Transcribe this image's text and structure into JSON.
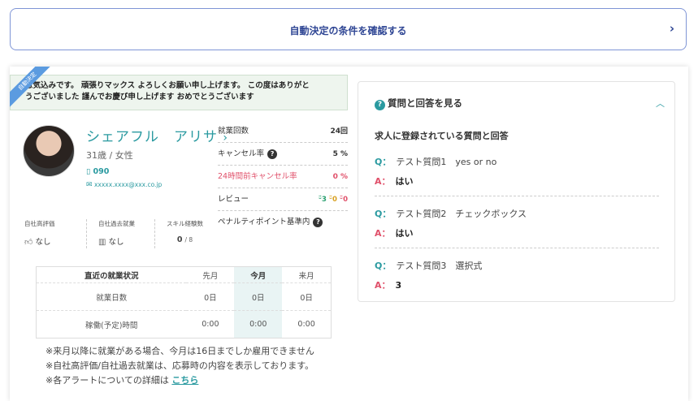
{
  "top_bar": {
    "label": "自動決定の条件を確認する",
    "chevron": "›"
  },
  "ribbon": "自動決定",
  "message": [
    "意気込みです。 頑張りマックス よろしくお願い申し上げます。 この度はありがと",
    "うございました 謹んでお慶び申し上げます おめでとうございます"
  ],
  "profile": {
    "name": "シェアフル　アリサ",
    "name_arrow": "›",
    "age_gender": "31歳 / 女性",
    "phone": "090",
    "email": "xxxxx.xxxx@xxx.co.jp"
  },
  "stats": {
    "work_count": {
      "label": "就業回数",
      "value": "24回"
    },
    "cancel_rate": {
      "label": "キャンセル率",
      "value": "5 %"
    },
    "cancel_24h": {
      "label": "24時間前キャンセル率",
      "value": "0 %"
    },
    "review": {
      "label": "レビュー",
      "good": "3",
      "neutral": "0",
      "bad": "0"
    },
    "penalty": {
      "label": "ペナルティポイント基準内"
    }
  },
  "evals": {
    "own_rating": {
      "label": "自社高評価",
      "value": "なし"
    },
    "own_past": {
      "label": "自社過去就業",
      "value": "なし"
    },
    "skill": {
      "label": "スキル経験数",
      "value": "0",
      "total": "/ 8"
    }
  },
  "table": {
    "headers": [
      "直近の就業状況",
      "先月",
      "今月",
      "来月"
    ],
    "rows": [
      [
        "就業日数",
        "0日",
        "0日",
        "0日"
      ],
      [
        "稼働(予定)時間",
        "0:00",
        "0:00",
        "0:00"
      ]
    ]
  },
  "notes": {
    "line1": "※来月以降に就業がある場合、今月は16日までしか雇用できません",
    "line2": "※自社高評価/自社過去就業は、応募時の内容を表示しております。",
    "line3": "※各アラートについての詳細は ",
    "link": "こちら"
  },
  "qa": {
    "header": "質問と回答を見る",
    "title": "求人に登録されている質問と回答",
    "q_prefix": "Q：",
    "a_prefix": "A：",
    "items": [
      {
        "q": "テスト質問1　yes or no",
        "a": "はい"
      },
      {
        "q": "テスト質問2　チェックボックス",
        "a": "はい"
      },
      {
        "q": "テスト質問3　選択式",
        "a": "3"
      }
    ]
  }
}
